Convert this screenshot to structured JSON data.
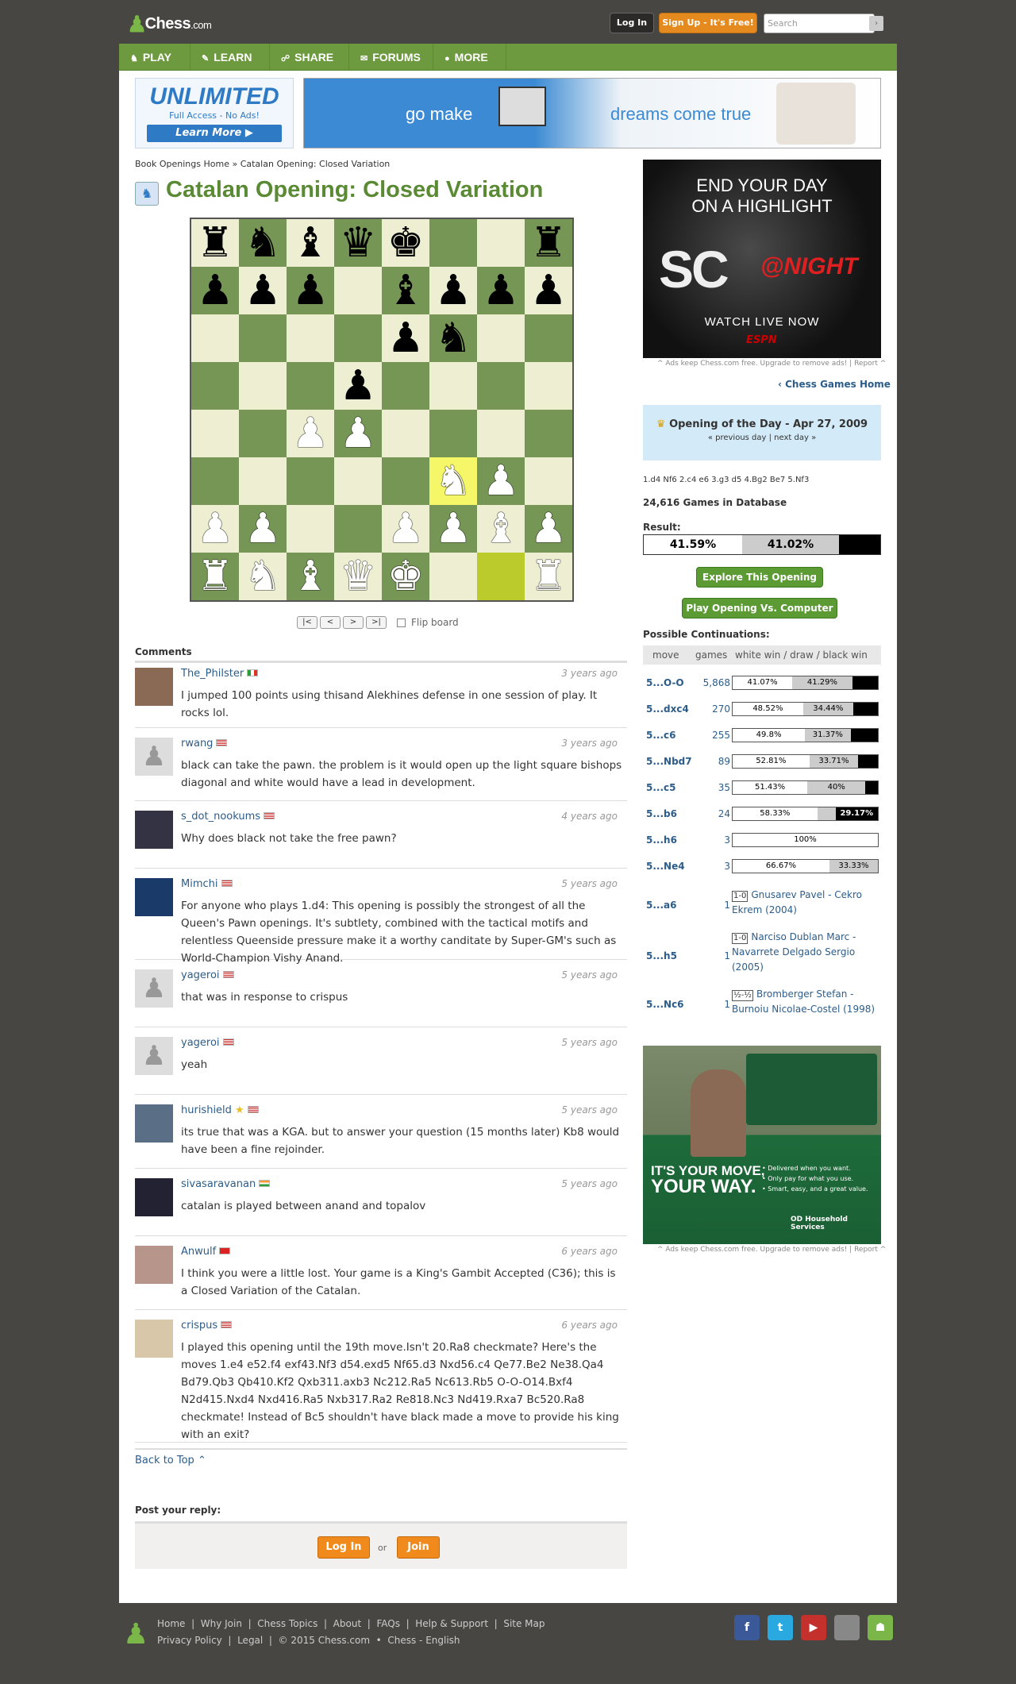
{
  "header": {
    "logo_text": "Chess",
    "logo_suffix": ".com",
    "login_label": "Log In",
    "signup_label": "Sign Up - It's Free!",
    "search_placeholder": "Search",
    "search_button": "›"
  },
  "nav": [
    {
      "label": "PLAY",
      "icon": "play-icon",
      "glyph": "♞"
    },
    {
      "label": "LEARN",
      "icon": "learn-icon",
      "glyph": "✎"
    },
    {
      "label": "SHARE",
      "icon": "share-icon",
      "glyph": "☍"
    },
    {
      "label": "FORUMS",
      "icon": "forums-icon",
      "glyph": "✉"
    },
    {
      "label": "MORE",
      "icon": "more-icon",
      "glyph": "●"
    }
  ],
  "ads": {
    "unlimited_title": "UNLIMITED",
    "unlimited_sub": "Full Access - No Ads!",
    "unlimited_btn": "Learn More ▶",
    "banner_text1": "go make",
    "banner_text2": "dreams come true",
    "sc_line1": "END YOUR DAY",
    "sc_line2": "ON A HIGHLIGHT",
    "sc_logo": "SC",
    "sc_night": "@NIGHT",
    "sc_watch": "WATCH LIVE NOW",
    "sc_espn": "ESPN",
    "note": "^ Ads keep Chess.com free. Upgrade to remove ads!  |  Report ^",
    "truck_h1": "IT'S YOUR MOVE,",
    "truck_h2": "YOUR WAY.",
    "truck_bullets": "• Delivered when you want.\n• Only pay for what you use.\n• Smart, easy, and a great value.",
    "truck_brand": "OD Household Services"
  },
  "breadcrumb": "Book Openings Home » Catalan Opening: Closed Variation",
  "page_title": "Catalan Opening: Closed Variation",
  "board": {
    "position": [
      [
        "r",
        "n",
        "b",
        "q",
        "k",
        "",
        "",
        "r"
      ],
      [
        "p",
        "p",
        "p",
        "",
        "b",
        "p",
        "p",
        "p"
      ],
      [
        "",
        "",
        "",
        "",
        "p",
        "n",
        "",
        ""
      ],
      [
        "",
        "",
        "",
        "p",
        "",
        "",
        "",
        ""
      ],
      [
        "",
        "",
        "P",
        "P",
        "",
        "",
        "",
        ""
      ],
      [
        "",
        "",
        "",
        "",
        "",
        "N",
        "P",
        ""
      ],
      [
        "P",
        "P",
        "",
        "",
        "P",
        "P",
        "B",
        "P"
      ],
      [
        "R",
        "N",
        "B",
        "Q",
        "K",
        "",
        "",
        "R"
      ]
    ],
    "highlight_light": "f3",
    "highlight_dark": "g1",
    "controls": [
      "|<",
      "<",
      ">",
      ">|"
    ],
    "flip_label": "Flip board"
  },
  "comments_heading": "Comments",
  "comments": [
    {
      "user": "The_Philster",
      "flag": "it",
      "time": "3 years ago",
      "text": "I jumped 100 points using thisand Alekhines defense in one session of play. It rocks lol."
    },
    {
      "user": "rwang",
      "flag": "us",
      "time": "3 years ago",
      "text": "black can take the pawn. the problem is it would open up the light square bishops diagonal and white would have a lead in development."
    },
    {
      "user": "s_dot_nookums",
      "flag": "us",
      "time": "4 years ago",
      "text": "Why does black not take the free pawn?"
    },
    {
      "user": "Mimchi",
      "flag": "us",
      "time": "5 years ago",
      "text": "For anyone who plays 1.d4: This opening is possibly the strongest of all the Queen's Pawn openings. It's subtlety, combined with the tactical motifs and relentless Queenside pressure make it a worthy canditate by Super-GM's such as World-Champion Vishy Anand."
    },
    {
      "user": "yageroi",
      "flag": "us",
      "time": "5 years ago",
      "text": "that was in response to crispus"
    },
    {
      "user": "yageroi",
      "flag": "us",
      "time": "5 years ago",
      "text": "yeah"
    },
    {
      "user": "hurishield",
      "flag": "us",
      "time": "5 years ago",
      "text": "its true that was a KGA. but to answer your question (15 months later) Kb8 would have been a fine rejoinder."
    },
    {
      "user": "sivasaravanan",
      "flag": "in",
      "time": "5 years ago",
      "text": "catalan is played between anand and topalov"
    },
    {
      "user": "Anwulf",
      "flag": "cn",
      "time": "6 years ago",
      "text": "I think you were a little lost. Your game is a King's Gambit Accepted (C36); this is a Closed Variation of the Catalan."
    },
    {
      "user": "crispus",
      "flag": "us",
      "time": "6 years ago",
      "text": "I played this opening until the 19th move.Isn't 20.Ra8 checkmate? Here's the moves 1.e4 e52.f4 exf43.Nf3 d54.exd5 Nf65.d3 Nxd56.c4 Qe77.Be2 Ne38.Qa4 Bd79.Qb3 Qb410.Kf2 Qxb311.axb3 Nc212.Ra5 Nc613.Rb5 O-O-O14.Bxf4 N2d415.Nxd4 Nxd416.Ra5 Nxb317.Ra2 Re818.Nc3 Nd419.Rxa7 Bc520.Ra8 checkmate! Instead of Bc5 shouldn't have black made a move to provide his king with an exit?"
    }
  ],
  "back_to_top": "Back to Top ⌃",
  "post_reply": {
    "heading": "Post your reply:",
    "login": "Log In",
    "or": "or",
    "join": "Join"
  },
  "sidebar": {
    "games_home": "‹ Chess Games Home",
    "otd_title": "Opening of the Day - Apr 27, 2009",
    "otd_nav": "« previous day  |  next day »",
    "moves": "1.d4 Nf6 2.c4 e6 3.g3 d5 4.Bg2 Be7 5.Nf3",
    "games_db": "24,616 Games in Database",
    "result_heading": "Result:",
    "result": {
      "white": 41.59,
      "draw": 41.02,
      "white_label": "41.59%",
      "draw_label": "41.02%"
    },
    "explore_btn": "Explore This Opening",
    "play_btn": "Play Opening Vs. Computer",
    "cont_heading": "Possible Continuations:",
    "cont_cols": [
      "move",
      "games",
      "white win / draw / black win"
    ],
    "continuations": [
      {
        "move": "5...O-O",
        "games": "5,868",
        "w": 41.07,
        "d": 41.29,
        "wl": "41.07%",
        "dl": "41.29%",
        "bl": ""
      },
      {
        "move": "5...dxc4",
        "games": "270",
        "w": 48.52,
        "d": 34.44,
        "wl": "48.52%",
        "dl": "34.44%",
        "bl": ""
      },
      {
        "move": "5...c6",
        "games": "255",
        "w": 49.8,
        "d": 31.37,
        "wl": "49.8%",
        "dl": "31.37%",
        "bl": ""
      },
      {
        "move": "5...Nbd7",
        "games": "89",
        "w": 52.81,
        "d": 33.71,
        "wl": "52.81%",
        "dl": "33.71%",
        "bl": ""
      },
      {
        "move": "5...c5",
        "games": "35",
        "w": 51.43,
        "d": 40,
        "wl": "51.43%",
        "dl": "40%",
        "bl": ""
      },
      {
        "move": "5...b6",
        "games": "24",
        "w": 58.33,
        "d": 12.5,
        "wl": "58.33%",
        "dl": "",
        "bl": "29.17%"
      },
      {
        "move": "5...h6",
        "games": "3",
        "w": 100,
        "d": 0,
        "wl": "100%",
        "dl": "",
        "bl": ""
      },
      {
        "move": "5...Ne4",
        "games": "3",
        "w": 66.67,
        "d": 33.33,
        "wl": "66.67%",
        "dl": "33.33%",
        "bl": ""
      }
    ],
    "single_games": [
      {
        "move": "5...a6",
        "games": "1",
        "res": "1-0",
        "desc": "Gnusarev Pavel - Cekro Ekrem (2004)"
      },
      {
        "move": "5...h5",
        "games": "1",
        "res": "1-0",
        "desc": "Narciso Dublan Marc - Navarrete Delgado Sergio (2005)"
      },
      {
        "move": "5...Nc6",
        "games": "1",
        "res": "½-½",
        "desc": "Bromberger Stefan - Burnoiu Nicolae-Costel (1998)"
      }
    ]
  },
  "footer": {
    "links1": "Home  |  Why Join  |  Chess Topics  |  About  |  FAQs  |  Help & Support  |  Site Map",
    "links2": "Privacy Policy  |  Legal  |  © 2015 Chess.com  •  Chess - English",
    "social": [
      "facebook-icon",
      "twitter-icon",
      "youtube-icon",
      "apple-icon",
      "android-icon"
    ]
  },
  "colors": {
    "brand_green": "#6e9a3f",
    "orange": "#f08a1d",
    "light_sq": "#eeeed2",
    "dark_sq": "#769656",
    "link": "#2c5d8a"
  }
}
